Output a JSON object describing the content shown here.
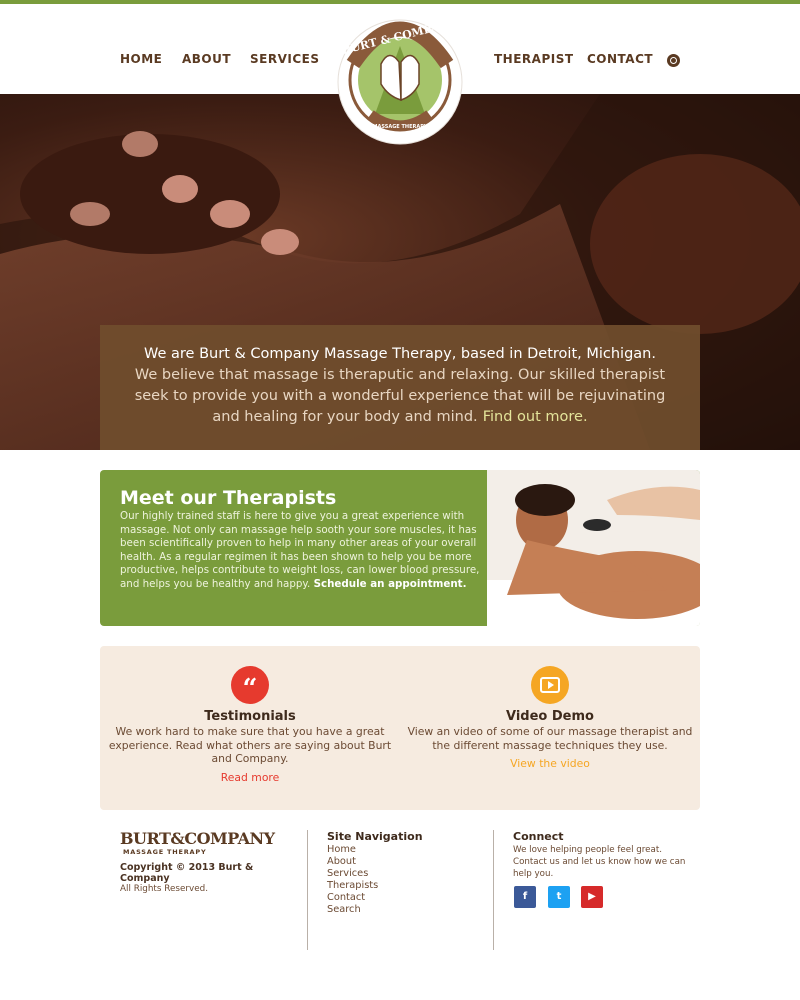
{
  "nav": {
    "home": "HOME",
    "about": "ABOUT",
    "services": "SERVICES",
    "therapist": "THERAPIST",
    "contact": "CONTACT"
  },
  "logo": {
    "name": "BURT & COMPANY",
    "tagline": "MASSAGE THERAPY"
  },
  "hero": {
    "line1": "We are Burt & Company Massage Therapy, based in Detroit, Michigan.",
    "body": "We believe that massage is theraputic and relaxing. Our skilled therapist seek to provide you with a wonderful experience that will  be rejuvinating and healing for your body and mind.",
    "link": "Find out more."
  },
  "therapists": {
    "title": "Meet our Therapists",
    "body": "Our highly trained staff is here to give you a great experience with massage.  Not only can massage help sooth your sore muscles, it has been scientifically proven to help in many other areas of your overall health. As a regular regimen it has been shown to help you be more productive, helps contribute to weight loss, can lower blood pressure, and helps you be healthy and happy.",
    "link": "Schedule an appointment."
  },
  "features": [
    {
      "icon": "quote-icon",
      "color": "#e63a2e",
      "title": "Testimonials",
      "body": "We work hard to make sure that you have a great experience. Read what others are saying about Burt and Company.",
      "link": "Read more",
      "link_color": "#e63a2e"
    },
    {
      "icon": "video-icon",
      "color": "#f5a623",
      "title": "Video Demo",
      "body": "View an video of some of our massage therapist and the different massage techniques they use.",
      "link": "View the video",
      "link_color": "#f5a623"
    }
  ],
  "footer": {
    "logo_name": "BURT&COMPANY",
    "logo_tagline": "MASSAGE THERAPY",
    "copyright": "Copyright © 2013 Burt & Company",
    "reserved": "All Rights Reserved.",
    "nav_title": "Site Navigation",
    "nav_items": [
      "Home",
      "About",
      "Services",
      "Therapists",
      "Contact",
      "Search"
    ],
    "connect_title": "Connect",
    "connect_text": "We love helping people feel great. Contact us and let us know how we can help you.",
    "social": [
      {
        "icon": "facebook-icon",
        "glyph": "f",
        "color": "#3b5998"
      },
      {
        "icon": "twitter-icon",
        "glyph": "t",
        "color": "#1da1f2"
      },
      {
        "icon": "youtube-icon",
        "glyph": "▶",
        "color": "#d62a2a"
      }
    ]
  },
  "colors": {
    "brand_green": "#7a9c3c",
    "brand_brown": "#5a3a22",
    "panel_cream": "#f6ebe0"
  }
}
